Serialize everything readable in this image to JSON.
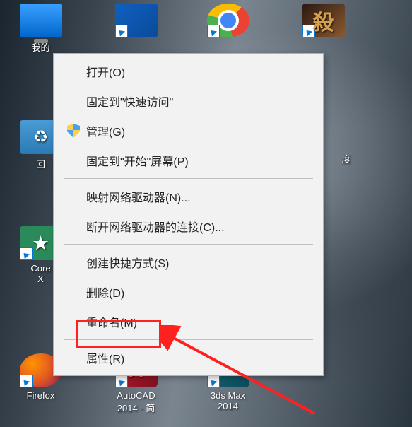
{
  "desktop_icons": {
    "my_computer": "我的",
    "recycle_bin": "回",
    "corel": "Core",
    "corel_sub": "X",
    "firefox": "Firefox",
    "autocad": "AutoCAD",
    "autocad_sub": "2014 - 简",
    "three_ds_max": "3ds Max",
    "three_ds_max_sub": "2014",
    "baidu": "度"
  },
  "context_menu": {
    "open": "打开(O)",
    "pin_quick_access": "固定到\"快速访问\"",
    "manage": "管理(G)",
    "pin_start": "固定到\"开始\"屏幕(P)",
    "map_drive": "映射网络驱动器(N)...",
    "disconnect_drive": "断开网络驱动器的连接(C)...",
    "create_shortcut": "创建快捷方式(S)",
    "delete": "删除(D)",
    "rename": "重命名(M)",
    "properties": "属性(R)"
  },
  "colors": {
    "menu_bg": "#f2f2f2",
    "menu_border": "#b0b0b0",
    "highlight": "#ff2020"
  }
}
